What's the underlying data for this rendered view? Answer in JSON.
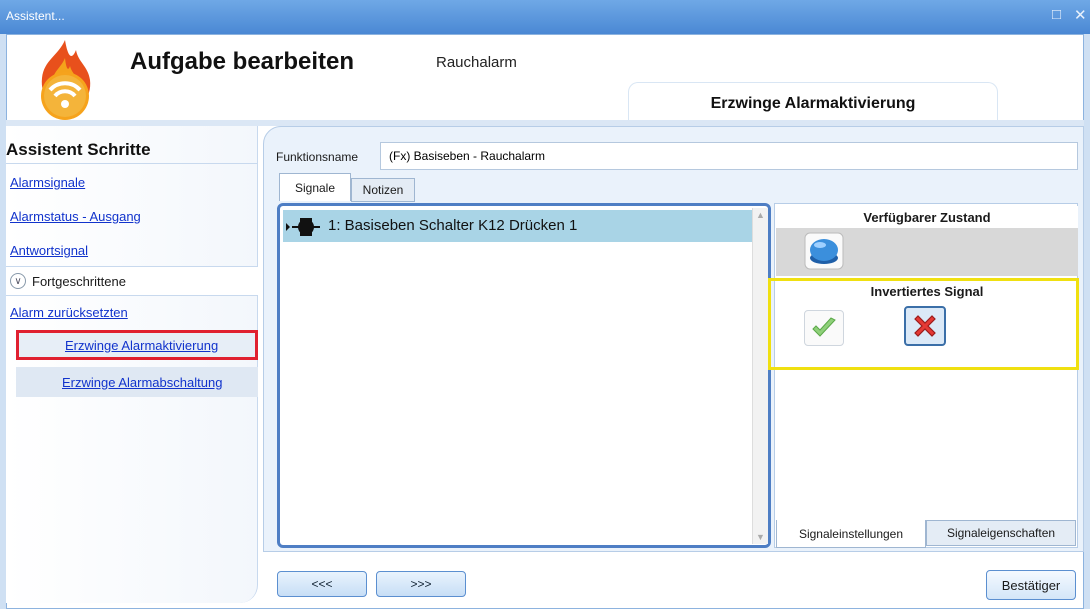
{
  "window": {
    "title": "Assistent..."
  },
  "header": {
    "title": "Aufgabe bearbeiten",
    "subtitle": "Rauchalarm",
    "step_title": "Erzwinge Alarmaktivierung"
  },
  "sidebar": {
    "heading": "Assistent Schritte",
    "items": [
      {
        "label": "Alarmsignale"
      },
      {
        "label": "Alarmstatus - Ausgang"
      },
      {
        "label": "Antwortsignal"
      }
    ],
    "advanced": {
      "label": "Fortgeschrittene",
      "items": [
        {
          "label": "Alarm zurücksetzten"
        },
        {
          "label": "Erzwinge Alarmaktivierung"
        },
        {
          "label": "Erzwinge Alarmabschaltung"
        }
      ]
    }
  },
  "main": {
    "function_name_label": "Funktionsname",
    "function_name_value": "(Fx) Basiseben - Rauchalarm",
    "tabs": [
      {
        "label": "Signale"
      },
      {
        "label": "Notizen"
      }
    ],
    "signals": [
      {
        "label": "1: Basiseben Schalter K12 Drücken 1"
      }
    ],
    "right_panel": {
      "available_state_title": "Verfügbarer Zustand",
      "inverted_signal_title": "Invertiertes Signal",
      "inverted_value": "no",
      "tabs": [
        {
          "label": "Signaleinstellungen"
        },
        {
          "label": "Signaleigenschaften"
        }
      ]
    }
  },
  "footer": {
    "back_label": "<<<",
    "next_label": ">>>",
    "confirm_label": "Bestätiger"
  },
  "colors": {
    "accent": "#4a88d4",
    "selection": "#a9d4e6",
    "highlight_red": "#e02030",
    "highlight_yellow": "#f0e010"
  },
  "icons": [
    "fire-wifi-logo",
    "switch-signal-icon",
    "blue-state-icon",
    "checkmark-icon",
    "x-icon",
    "chevron-down-icon",
    "maximize-icon",
    "close-icon"
  ]
}
